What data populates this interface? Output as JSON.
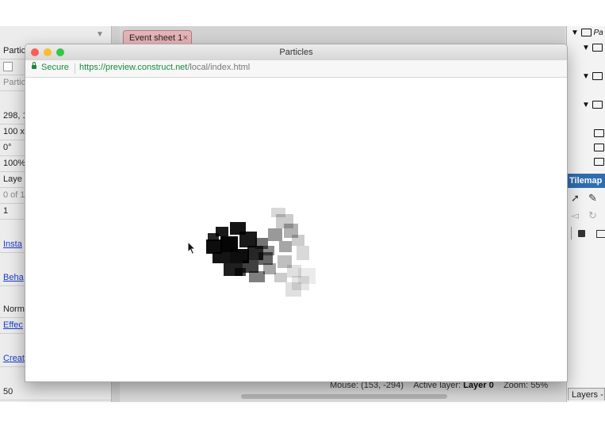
{
  "editor": {
    "left_panel": {
      "rows": [
        {
          "text": "Partic",
          "style": "normal"
        },
        {
          "text": "",
          "style": "checkbox"
        },
        {
          "text": "Partic",
          "style": "grey"
        },
        {
          "text": "298, 1",
          "style": "normal"
        },
        {
          "text": "100 x",
          "style": "normal"
        },
        {
          "text": "0°",
          "style": "normal"
        },
        {
          "text": "100%",
          "style": "normal"
        },
        {
          "text": "Laye",
          "style": "normal"
        },
        {
          "text": "0 of 1",
          "style": "grey"
        },
        {
          "text": "1",
          "style": "normal"
        },
        {
          "text": "Insta",
          "style": "link"
        },
        {
          "text": "Beha",
          "style": "link"
        },
        {
          "text": "Norm",
          "style": "normal"
        },
        {
          "text": "Effec",
          "style": "link"
        },
        {
          "text": "Creat",
          "style": "link"
        },
        {
          "text": "50",
          "style": "normal"
        }
      ]
    },
    "tab": {
      "label": "Event sheet 1",
      "close": "×"
    },
    "right_panel": {
      "root_label": "Pa",
      "tilemap_title": "Tilemap",
      "layers_tab": "Layers -"
    },
    "status": {
      "mouse_label": "Mouse:",
      "mouse_value": "(153, -294)",
      "active_layer_label": "Active layer:",
      "active_layer_value": "Layer 0",
      "zoom_label": "Zoom:",
      "zoom_value": "55%"
    }
  },
  "browser": {
    "title": "Particles",
    "secure_label": "Secure",
    "url_scheme": "https://",
    "url_host": "preview.construct.net",
    "url_path": "/local/index.html",
    "traffic_lights": {
      "close": "#fc5f57",
      "minimize": "#fdbc2e",
      "zoom": "#33c748"
    }
  },
  "particles": {
    "cells": [
      [
        230,
        46,
        14,
        10,
        0.85
      ],
      [
        240,
        38,
        16,
        12,
        0.9
      ],
      [
        258,
        32,
        20,
        16,
        0.92
      ],
      [
        228,
        54,
        20,
        18,
        0.95
      ],
      [
        246,
        50,
        22,
        20,
        0.98
      ],
      [
        270,
        44,
        22,
        20,
        0.9
      ],
      [
        236,
        70,
        22,
        14,
        0.92
      ],
      [
        258,
        66,
        24,
        18,
        0.95
      ],
      [
        280,
        62,
        20,
        18,
        0.85
      ],
      [
        250,
        84,
        24,
        16,
        0.88
      ],
      [
        274,
        80,
        20,
        16,
        0.75
      ],
      [
        294,
        70,
        18,
        16,
        0.6
      ],
      [
        290,
        52,
        16,
        14,
        0.55
      ],
      [
        306,
        40,
        18,
        16,
        0.4
      ],
      [
        316,
        22,
        22,
        18,
        0.2
      ],
      [
        310,
        14,
        18,
        12,
        0.15
      ],
      [
        326,
        34,
        18,
        18,
        0.3
      ],
      [
        320,
        56,
        16,
        14,
        0.35
      ],
      [
        336,
        48,
        16,
        14,
        0.2
      ],
      [
        342,
        62,
        16,
        18,
        0.15
      ],
      [
        300,
        84,
        16,
        14,
        0.35
      ],
      [
        282,
        94,
        20,
        14,
        0.5
      ],
      [
        318,
        74,
        18,
        16,
        0.25
      ],
      [
        330,
        86,
        18,
        16,
        0.12
      ],
      [
        336,
        100,
        22,
        18,
        0.1
      ],
      [
        344,
        90,
        22,
        20,
        0.08
      ],
      [
        328,
        108,
        20,
        18,
        0.12
      ],
      [
        314,
        96,
        16,
        12,
        0.2
      ],
      [
        300,
        62,
        14,
        12,
        0.45
      ],
      [
        264,
        90,
        14,
        10,
        0.7
      ]
    ]
  }
}
